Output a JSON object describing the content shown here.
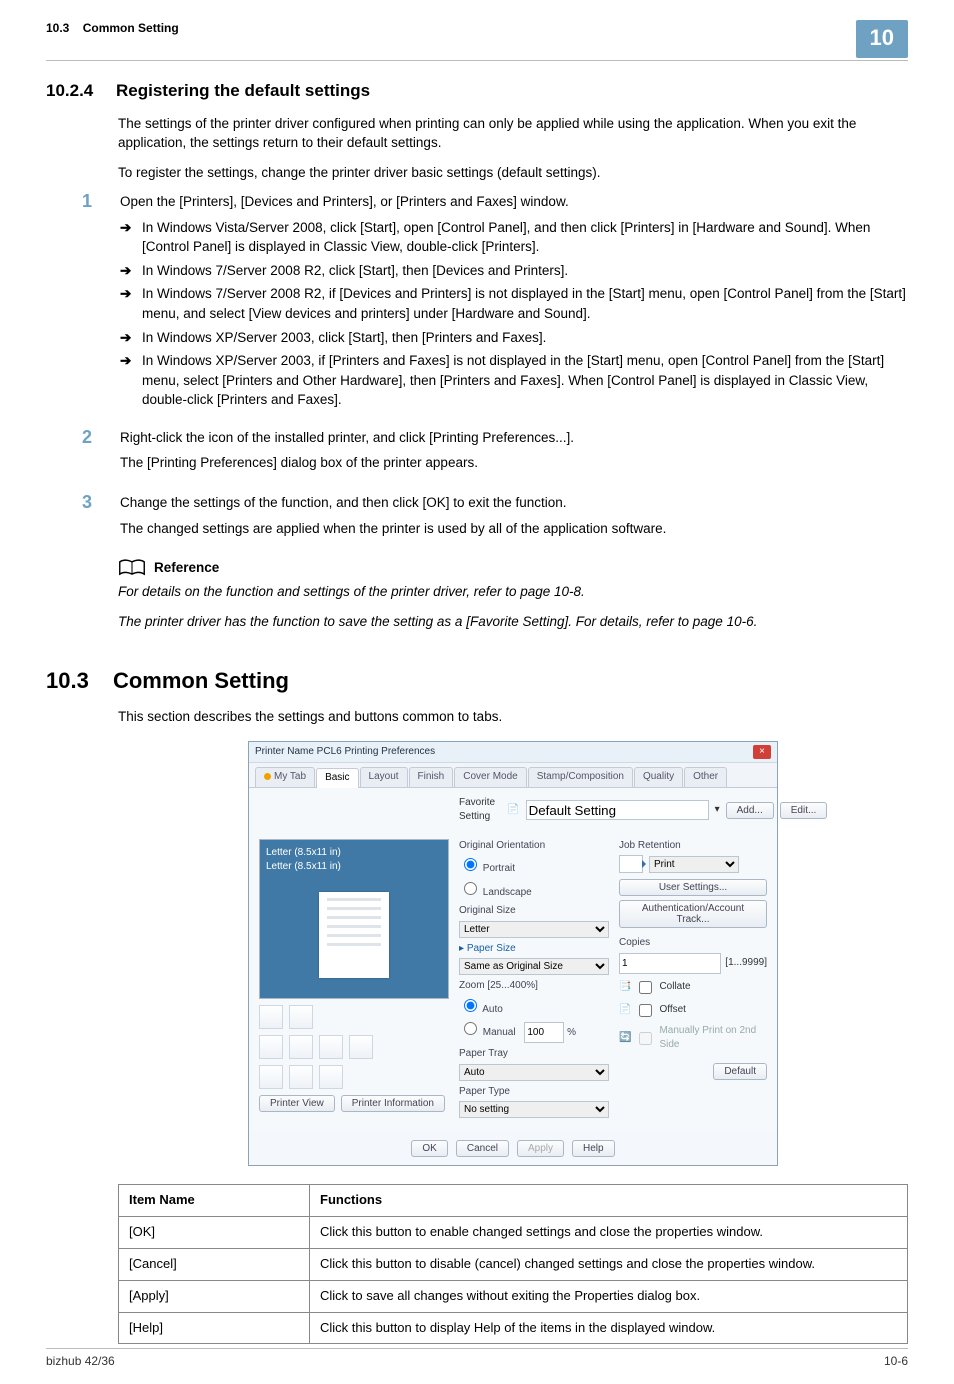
{
  "header": {
    "section_no": "10.3",
    "section_title": "Common Setting",
    "chapter_badge": "10"
  },
  "h1": {
    "num": "10.2.4",
    "title": "Registering the default settings"
  },
  "intro": [
    "The settings of the printer driver configured when printing can only be applied while using the application. When you exit the application, the settings return to their default settings.",
    "To register the settings, change the printer driver basic settings (default settings)."
  ],
  "steps": [
    {
      "no": "1",
      "lead": "Open the [Printers], [Devices and Printers], or [Printers and Faxes] window.",
      "arrows": [
        "In Windows Vista/Server 2008, click [Start], open [Control Panel], and then click [Printers] in [Hardware and Sound]. When [Control Panel] is displayed in Classic View, double-click [Printers].",
        "In Windows 7/Server 2008 R2, click [Start], then [Devices and Printers].",
        "In Windows 7/Server 2008 R2, if [Devices and Printers] is not displayed in the [Start] menu, open [Control Panel] from the [Start] menu, and select [View devices and printers] under [Hardware and Sound].",
        "In Windows XP/Server 2003, click [Start], then [Printers and Faxes].",
        "In Windows XP/Server 2003, if [Printers and Faxes] is not displayed in the [Start] menu, open [Control Panel] from the [Start] menu, select [Printers and Other Hardware], then [Printers and Faxes]. When [Control Panel] is displayed in Classic View, double-click [Printers and Faxes]."
      ]
    },
    {
      "no": "2",
      "lead": "Right-click the icon of the installed printer, and click [Printing Preferences...].",
      "after": "The [Printing Preferences] dialog box of the printer appears."
    },
    {
      "no": "3",
      "lead": "Change the settings of the function, and then click [OK] to exit the function.",
      "after": "The changed settings are applied when the printer is used by all of the application software."
    }
  ],
  "reference": {
    "label": "Reference",
    "lines": [
      "For details on the function and settings of the printer driver, refer to page 10-8.",
      "The printer driver has the function to save the setting as a [Favorite Setting]. For details, refer to page 10-6."
    ]
  },
  "section": {
    "num": "10.3",
    "title": "Common Setting",
    "intro": "This section describes the settings and buttons common to tabs."
  },
  "shot": {
    "title": "Printer Name PCL6 Printing Preferences",
    "tabs": [
      "My Tab",
      "Basic",
      "Layout",
      "Finish",
      "Cover Mode",
      "Stamp/Composition",
      "Quality",
      "Other"
    ],
    "active_tab": 1,
    "favorite_label": "Favorite Setting",
    "default_setting_label": "Default Setting",
    "add_btn": "Add...",
    "edit_btn": "Edit...",
    "preview_line1": "Letter (8.5x11 in)",
    "preview_line2": "Letter (8.5x11 in)",
    "printer_view_btn": "Printer View",
    "printer_info_btn": "Printer Information",
    "orig_orientation": "Original Orientation",
    "portrait": "Portrait",
    "landscape": "Landscape",
    "orig_size": "Original Size",
    "orig_size_val": "Letter",
    "paper_size": "Paper Size",
    "paper_size_val": "Same as Original Size",
    "zoom": "Zoom [25...400%]",
    "zoom_auto": "Auto",
    "zoom_manual": "Manual",
    "zoom_val": "100",
    "zoom_pct": "%",
    "paper_tray": "Paper Tray",
    "paper_tray_val": "Auto",
    "paper_type": "Paper Type",
    "paper_type_val": "No setting",
    "job_retention": "Job Retention",
    "job_retention_val": "Print",
    "user_settings": "User Settings...",
    "auth_track": "Authentication/Account Track...",
    "copies": "Copies",
    "copies_val": "1",
    "copies_range": "[1...9999]",
    "collate": "Collate",
    "offset": "Offset",
    "manual_2nd": "Manually Print on 2nd Side",
    "default_btn": "Default",
    "ok": "OK",
    "cancel": "Cancel",
    "apply": "Apply",
    "help": "Help"
  },
  "table": {
    "head": [
      "Item Name",
      "Functions"
    ],
    "rows": [
      [
        "[OK]",
        "Click this button to enable changed settings and close the properties window."
      ],
      [
        "[Cancel]",
        "Click this button to disable (cancel) changed settings and close the properties window."
      ],
      [
        "[Apply]",
        "Click to save all changes without exiting the Properties dialog box."
      ],
      [
        "[Help]",
        "Click this button to display Help of the items in the displayed window."
      ]
    ]
  },
  "footer": {
    "left": "bizhub 42/36",
    "right": "10-6"
  }
}
